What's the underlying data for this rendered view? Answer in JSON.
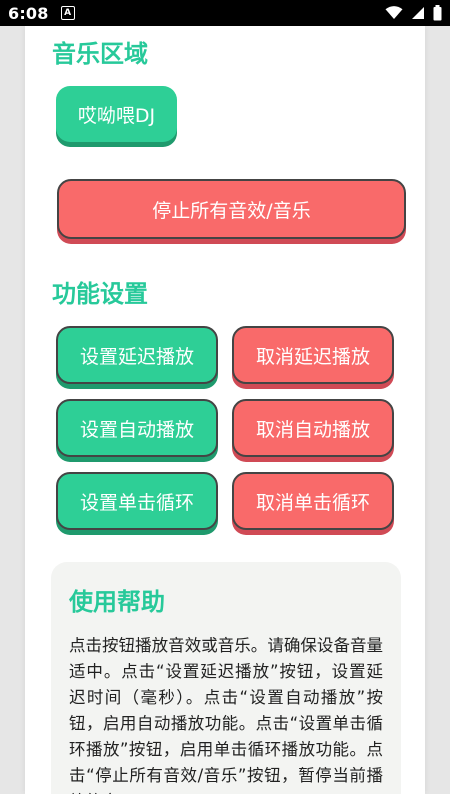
{
  "status_bar": {
    "time": "6:08",
    "notification_letter": "A"
  },
  "music": {
    "title": "音乐区域",
    "dj_button": "哎呦喂DJ",
    "stop_all_button": "停止所有音效/音乐"
  },
  "settings": {
    "title": "功能设置",
    "set_delay": "设置延迟播放",
    "cancel_delay": "取消延迟播放",
    "set_auto": "设置自动播放",
    "cancel_auto": "取消自动播放",
    "set_loop": "设置单击循环",
    "cancel_loop": "取消单击循环"
  },
  "help": {
    "title": "使用帮助",
    "text": "点击按钮播放音效或音乐。请确保设备音量适中。点击“设置延迟播放”按钮，设置延迟时间（毫秒）。点击“设置自动播放”按钮，启用自动播放功能。点击“设置单击循环播放”按钮，启用单击循环播放功能。点击“停止所有音效/音乐”按钮，暂停当前播放的音"
  },
  "colors": {
    "accent": "#27c99a",
    "green_button": "#2ecf96",
    "red_button": "#f96a6a"
  }
}
